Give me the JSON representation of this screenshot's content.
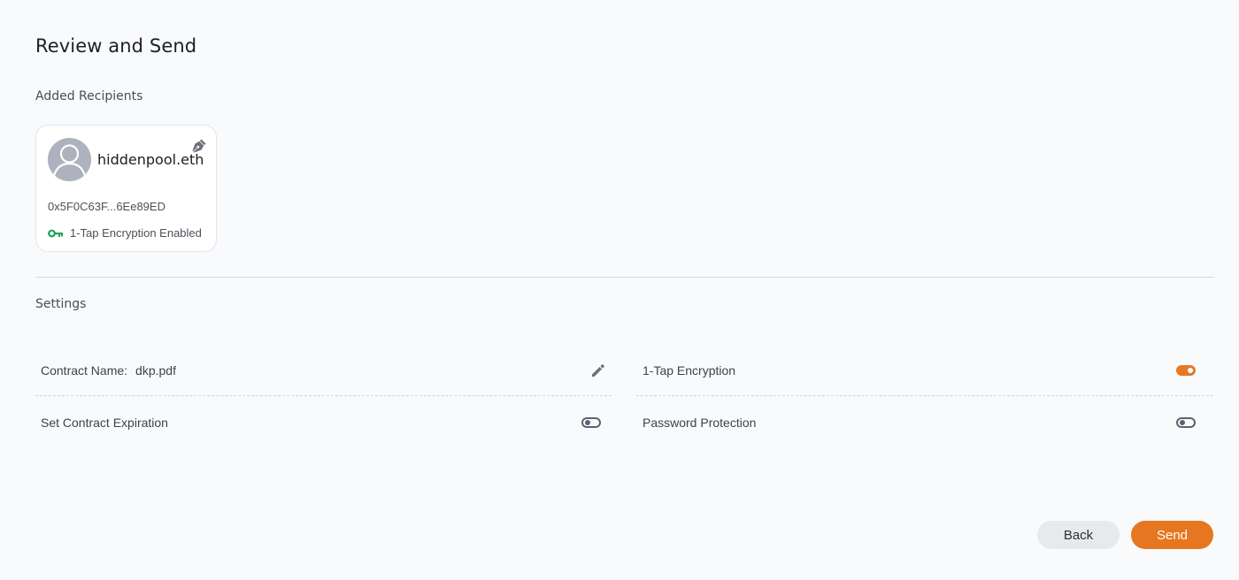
{
  "page": {
    "title": "Review and Send"
  },
  "recipients": {
    "heading": "Added Recipients",
    "items": [
      {
        "name": "hiddenpool.eth",
        "address": "0x5F0C63F...6Ee89ED",
        "encryption_status": "1-Tap Encryption Enabled",
        "avatar_icon": "user-avatar-icon",
        "role_icon": "signer-pen-icon"
      }
    ]
  },
  "settings": {
    "heading": "Settings",
    "contract_name": {
      "label": "Contract Name:",
      "value": "dkp.pdf",
      "edit_icon": "pencil-icon"
    },
    "contract_expiration": {
      "label": "Set Contract Expiration",
      "enabled": false
    },
    "one_tap_encryption": {
      "label": "1-Tap Encryption",
      "enabled": true
    },
    "password_protection": {
      "label": "Password Protection",
      "enabled": false
    }
  },
  "actions": {
    "back_label": "Back",
    "send_label": "Send"
  },
  "colors": {
    "accent": "#e6761f",
    "key_icon": "#1aa55a",
    "avatar_bg": "#aeb2bf",
    "background": "#f9fafc"
  }
}
